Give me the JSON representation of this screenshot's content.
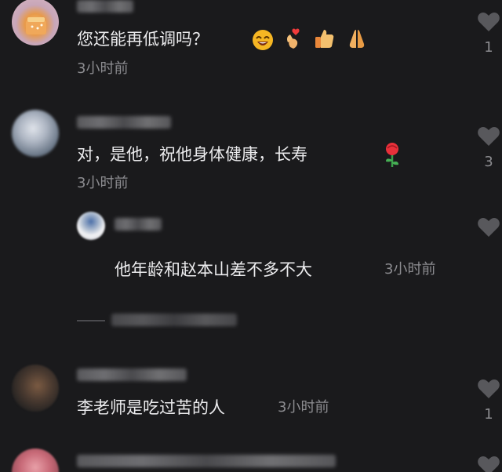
{
  "comments": [
    {
      "name_blurred": "摇晃六",
      "text": "您还能再低调吗？",
      "time": "3小时前",
      "likes": "1",
      "emojis": [
        "grinning-face-icon",
        "finger-heart-icon",
        "thumbs-up-icon",
        "folded-hands-icon"
      ]
    },
    {
      "name_blurred": "Robin Hao",
      "text": "对，是他，祝他身体健康，长寿",
      "time": "3小时前",
      "likes": "3",
      "emojis": [
        "rose-icon"
      ]
    },
    {
      "reply": true,
      "text": "他年龄和赵本山差不多不大",
      "time": "3小时前"
    },
    {
      "text": "李老师是吃过苦的人",
      "time": "3小时前",
      "likes": "1"
    }
  ],
  "colors": {
    "background": "#1a1a1c",
    "text": "#ececee",
    "muted": "#8c8c90",
    "heart": "#5a5a5e"
  }
}
